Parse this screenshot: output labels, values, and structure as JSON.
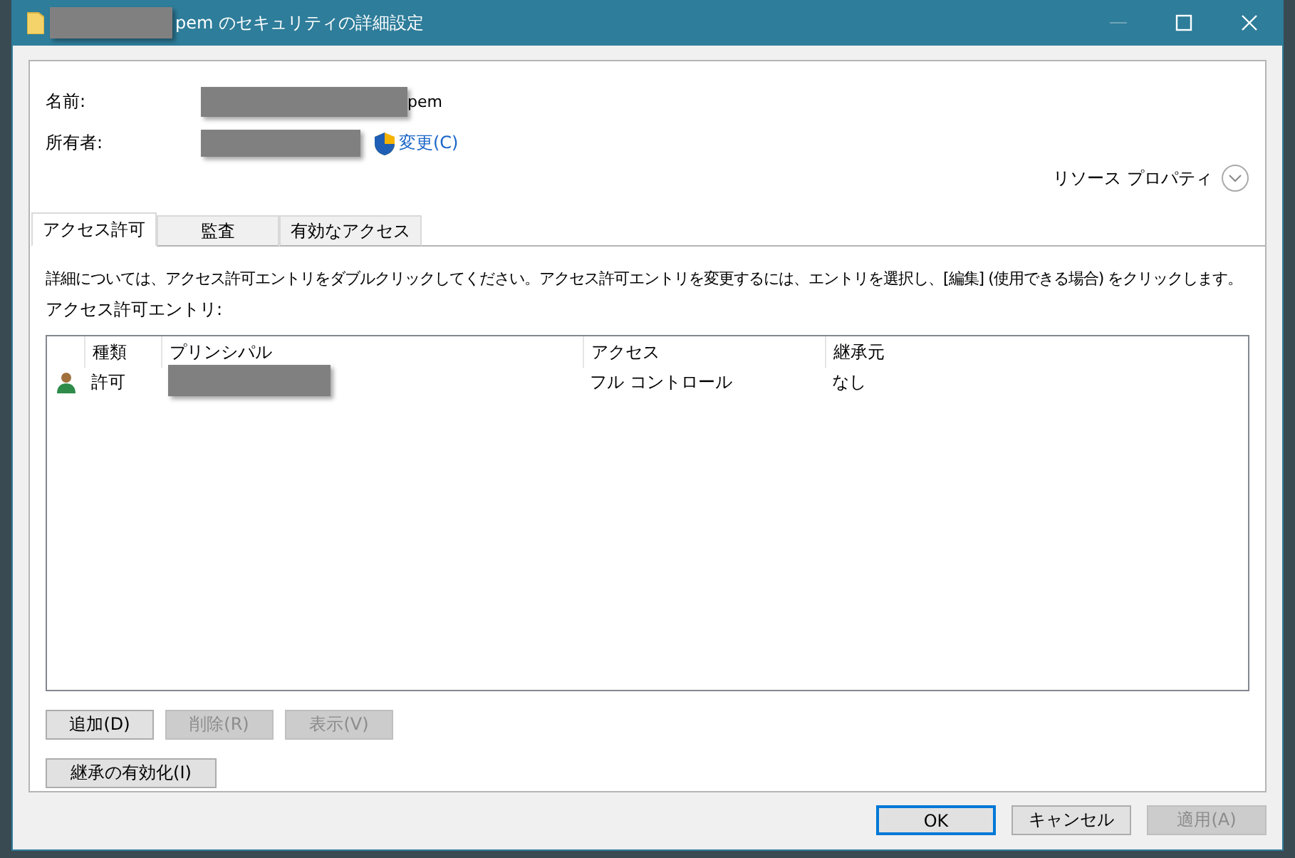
{
  "window": {
    "title": "pem のセキュリティの詳細設定"
  },
  "name_field": {
    "label": "名前:",
    "value": "pem"
  },
  "owner_field": {
    "label": "所有者:",
    "change_link": "変更(C)"
  },
  "resource_properties": "リソース プロパティ",
  "tabs": [
    {
      "label": "アクセス許可",
      "selected": true
    },
    {
      "label": "監査",
      "selected": false
    },
    {
      "label": "有効なアクセス",
      "selected": false
    }
  ],
  "instructions": "詳細については、アクセス許可エントリをダブルクリックしてください。アクセス許可エントリを変更するには、エントリを選択し、[編集] (使用できる場合) をクリックします。",
  "entries_label": "アクセス許可エントリ:",
  "table": {
    "columns": [
      "種類",
      "プリンシパル",
      "アクセス",
      "継承元"
    ],
    "rows": [
      {
        "type": "許可",
        "access": "フル コントロール",
        "inherited_from": "なし"
      }
    ]
  },
  "entry_buttons": [
    {
      "label": "追加(D)",
      "disabled": false
    },
    {
      "label": "削除(R)",
      "disabled": true
    },
    {
      "label": "表示(V)",
      "disabled": true
    }
  ],
  "inheritance_button": {
    "label": "継承の有効化(I)",
    "disabled": false
  },
  "dialog_buttons": [
    {
      "label": "OK",
      "default": true,
      "disabled": false
    },
    {
      "label": "キャンセル",
      "default": false,
      "disabled": false
    },
    {
      "label": "適用(A)",
      "default": false,
      "disabled": true
    }
  ]
}
